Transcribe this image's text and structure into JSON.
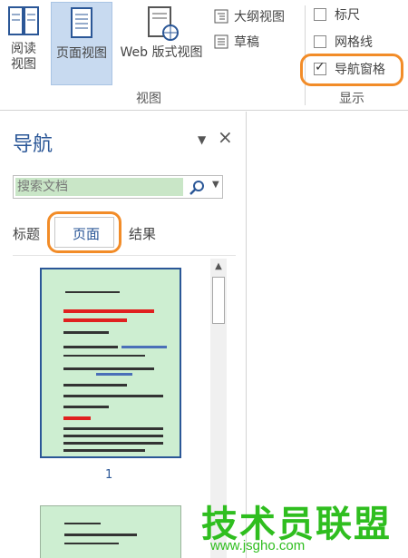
{
  "ribbon": {
    "reading_view": "阅读视图",
    "print_layout": "页面视图",
    "web_layout": "Web 版式视图",
    "outline": "大纲视图",
    "draft": "草稿",
    "views_group": "视图",
    "ruler": "标尺",
    "gridlines": "网格线",
    "navigation_pane": "导航窗格",
    "navigation_pane_checked": true,
    "show_group": "显示"
  },
  "nav": {
    "title": "导航",
    "search_value": "搜索文档",
    "tabs": [
      "标题",
      "页面",
      "结果"
    ],
    "active_tab": "页面",
    "page_numbers": [
      "1"
    ]
  },
  "watermark": {
    "title": "技术员联盟",
    "url": "www.jsgho.com"
  },
  "colors": {
    "accent": "#2b5797",
    "highlight": "#f28c28",
    "thumbnail_bg": "#cdeed1",
    "watermark": "#2fbe1f"
  }
}
